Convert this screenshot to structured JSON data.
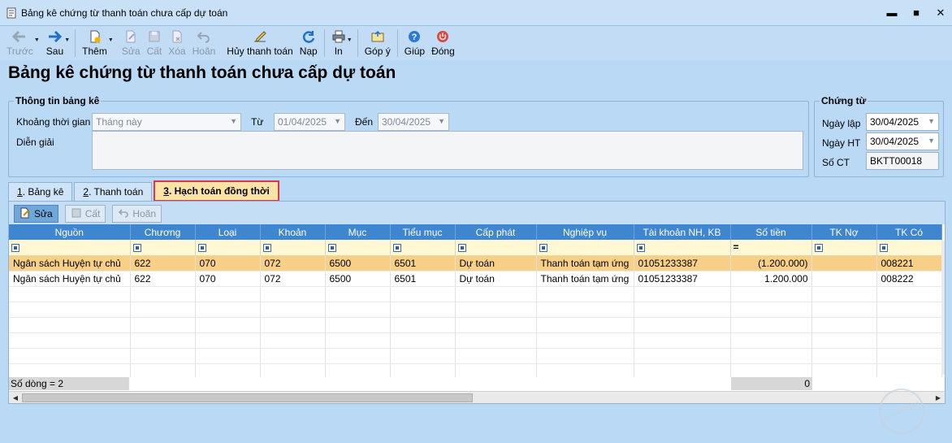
{
  "window": {
    "title": "Bảng kê chứng từ thanh toán chưa cấp dự toán",
    "controls": [
      "▬",
      "■",
      "✕"
    ]
  },
  "toolbar": {
    "buttons": [
      {
        "label": "Trước",
        "icon": "arrow-left-icon",
        "disabled": true
      },
      {
        "label": "Sau",
        "icon": "arrow-right-icon",
        "disabled": false
      },
      {
        "label": "Thêm",
        "icon": "add-doc-icon",
        "disabled": false
      },
      {
        "label": "Sửa",
        "icon": "edit-icon",
        "disabled": true
      },
      {
        "label": "Cất",
        "icon": "save-icon",
        "disabled": true
      },
      {
        "label": "Xóa",
        "icon": "delete-icon",
        "disabled": true
      },
      {
        "label": "Hoãn",
        "icon": "undo-icon",
        "disabled": true
      },
      {
        "label": "Hủy thanh toán",
        "icon": "cancel-pay-icon",
        "disabled": false
      },
      {
        "label": "Nạp",
        "icon": "refresh-icon",
        "disabled": false
      },
      {
        "label": "In",
        "icon": "print-icon",
        "disabled": false
      },
      {
        "label": "Góp ý",
        "icon": "feedback-icon",
        "disabled": false
      },
      {
        "label": "Giúp",
        "icon": "help-icon",
        "disabled": false
      },
      {
        "label": "Đóng",
        "icon": "power-icon",
        "disabled": false
      }
    ]
  },
  "page_title": "Bảng kê chứng từ thanh toán chưa cấp dự toán",
  "info_group": {
    "legend": "Thông tin bảng kê",
    "period_label": "Khoảng thời gian",
    "period_value": "Tháng này",
    "from_label": "Từ",
    "from_value": "01/04/2025",
    "to_label": "Đến",
    "to_value": "30/04/2025",
    "desc_label": "Diễn giải"
  },
  "voucher_group": {
    "legend": "Chứng từ",
    "date_label": "Ngày lập",
    "date_value": "30/04/2025",
    "ht_label": "Ngày HT",
    "ht_value": "30/04/2025",
    "no_label": "Số CT",
    "no_value": "BKTT00018"
  },
  "tabs": [
    {
      "num": "1",
      "label": ". Bảng kê"
    },
    {
      "num": "2",
      "label": ". Thanh toán"
    },
    {
      "num": "3",
      "label": ". Hạch toán đồng thời"
    }
  ],
  "subtoolbar": {
    "edit": "Sửa",
    "save": "Cất",
    "undo": "Hoãn"
  },
  "grid": {
    "columns": [
      "Nguồn",
      "Chương",
      "Loại",
      "Khoản",
      "Mục",
      "Tiểu mục",
      "Cấp phát",
      "Nghiệp vụ",
      "Tài khoản NH, KB",
      "Số tiền",
      "TK Nợ",
      "TK Có"
    ],
    "filter_eq": "=",
    "rows": [
      [
        "Ngân sách Huyện tự chủ",
        "622",
        "070",
        "072",
        "6500",
        "6501",
        "Dự toán",
        "Thanh toán tạm ứng",
        "01051233387",
        "(1.200.000)",
        "",
        "008221"
      ],
      [
        "Ngân sách Huyện tự chủ",
        "622",
        "070",
        "072",
        "6500",
        "6501",
        "Dự toán",
        "Thanh toán tạm ứng",
        "01051233387",
        "1.200.000",
        "",
        "008222"
      ]
    ],
    "row_count": "Số dòng = 2",
    "sum": "0"
  },
  "watermark": "DỮ LIỆU MẪU",
  "colors": {
    "accent": "#3f86d0",
    "selected_row": "#f7cf86",
    "tab_highlight": "#e0364b"
  }
}
